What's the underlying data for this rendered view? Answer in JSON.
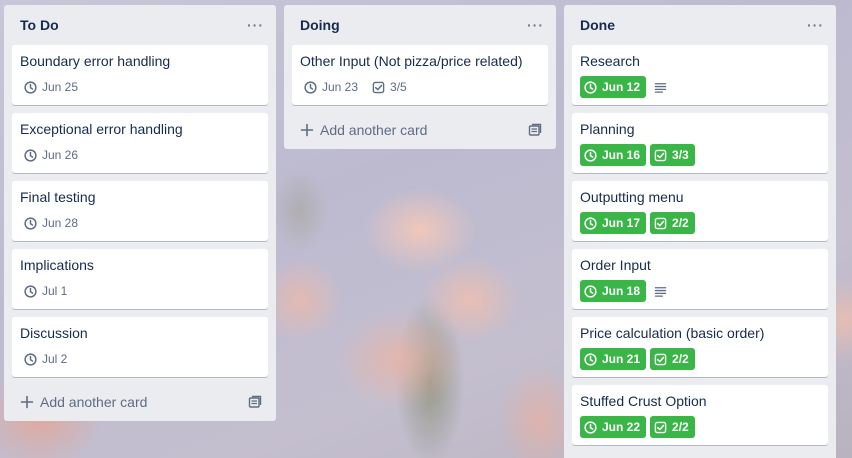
{
  "lists": [
    {
      "title": "To Do",
      "menu": "···",
      "cards": [
        {
          "title": "Boundary error handling",
          "due": "Jun 25"
        },
        {
          "title": "Exceptional error handling",
          "due": "Jun 26"
        },
        {
          "title": "Final testing",
          "due": "Jun 28"
        },
        {
          "title": "Implications",
          "due": "Jul 1"
        },
        {
          "title": "Discussion",
          "due": "Jul 2"
        }
      ],
      "add_label": "Add another card"
    },
    {
      "title": "Doing",
      "menu": "···",
      "cards": [
        {
          "title": "Other Input (Not pizza/price related)",
          "due": "Jun 23",
          "checklist": "3/5"
        }
      ],
      "add_label": "Add another card"
    },
    {
      "title": "Done",
      "menu": "···",
      "cards": [
        {
          "title": "Research",
          "due": "Jun 12",
          "has_description": true
        },
        {
          "title": "Planning",
          "due": "Jun 16",
          "checklist": "3/3"
        },
        {
          "title": "Outputting menu",
          "due": "Jun 17",
          "checklist": "2/2"
        },
        {
          "title": "Order Input",
          "due": "Jun 18",
          "has_description": true
        },
        {
          "title": "Price calculation (basic order)",
          "due": "Jun 21",
          "checklist": "2/2"
        },
        {
          "title": "Stuffed Crust Option",
          "due": "Jun 22",
          "checklist": "2/2"
        }
      ]
    }
  ],
  "colors": {
    "list_bg": "#ebecf0",
    "card_bg": "#ffffff",
    "complete_badge": "#3ab547",
    "text": "#172b4d",
    "muted": "#5e6c84"
  },
  "icons": {
    "due": "clock-icon",
    "checklist": "checklist-icon",
    "description": "description-icon",
    "add": "plus-icon",
    "template": "card-template-icon",
    "menu": "list-menu-icon"
  }
}
